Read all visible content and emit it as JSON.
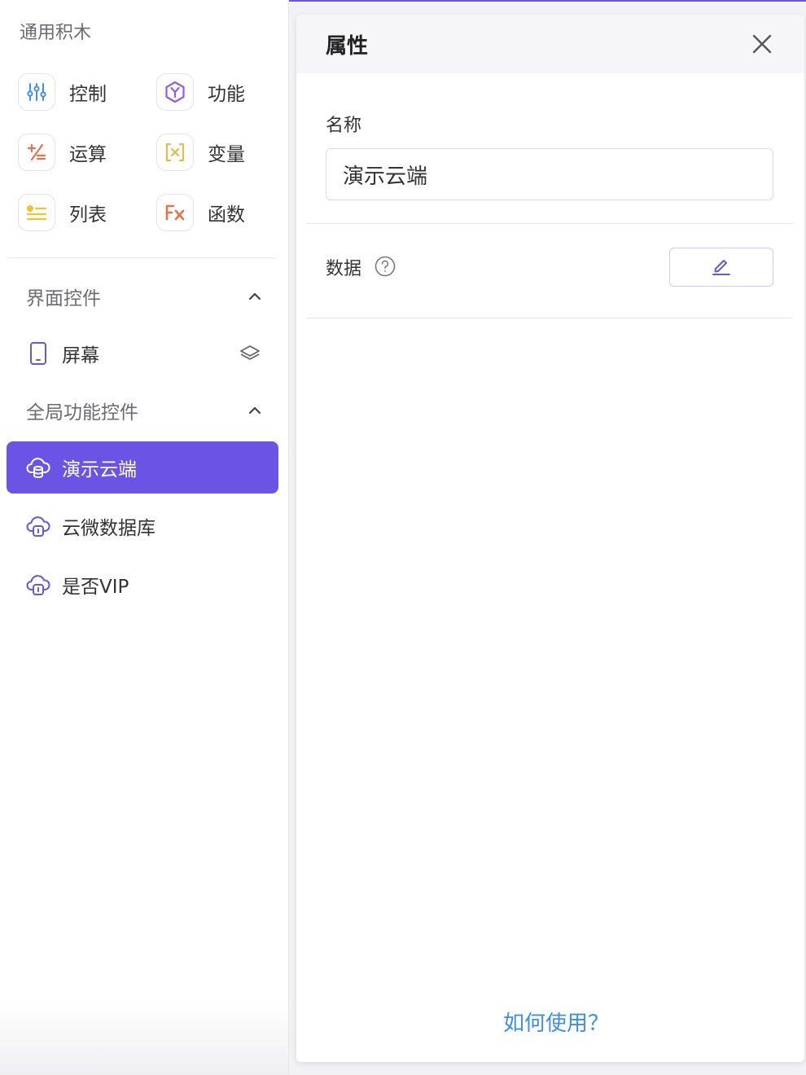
{
  "sidebar": {
    "section_title": "通用积木",
    "blocks": [
      {
        "label": "控制",
        "icon": "sliders-icon",
        "color": "#3b8fe8"
      },
      {
        "label": "功能",
        "icon": "hexagon-y-icon",
        "color": "#8b5cf6"
      },
      {
        "label": "运算",
        "icon": "plus-minus-icon",
        "color": "#e8734a"
      },
      {
        "label": "变量",
        "icon": "bracket-x-icon",
        "color": "#e9b949"
      },
      {
        "label": "列表",
        "icon": "list-icon",
        "color": "#f2c230"
      },
      {
        "label": "函数",
        "icon": "fx-icon",
        "color": "#e8734a"
      }
    ],
    "groups": [
      {
        "title": "界面控件",
        "items": [
          {
            "label": "屏幕",
            "icon": "phone-icon",
            "trailing_icon": "layers-icon"
          }
        ]
      },
      {
        "title": "全局功能控件",
        "items": [
          {
            "label": "演示云端",
            "icon": "cloud-database-icon",
            "active": true
          },
          {
            "label": "云微数据库",
            "icon": "cloud-database-icon"
          },
          {
            "label": "是否VIP",
            "icon": "cloud-database-icon"
          }
        ]
      }
    ]
  },
  "panel": {
    "title": "属性",
    "close_icon": "close-icon",
    "name_label": "名称",
    "name_value": "演示云端",
    "data_label": "数据",
    "help_icon": "question-circle-icon",
    "edit_icon": "pencil-icon",
    "help_link": "如何使用？"
  },
  "colors": {
    "accent": "#6b53e6",
    "link": "#3b8fe8"
  }
}
